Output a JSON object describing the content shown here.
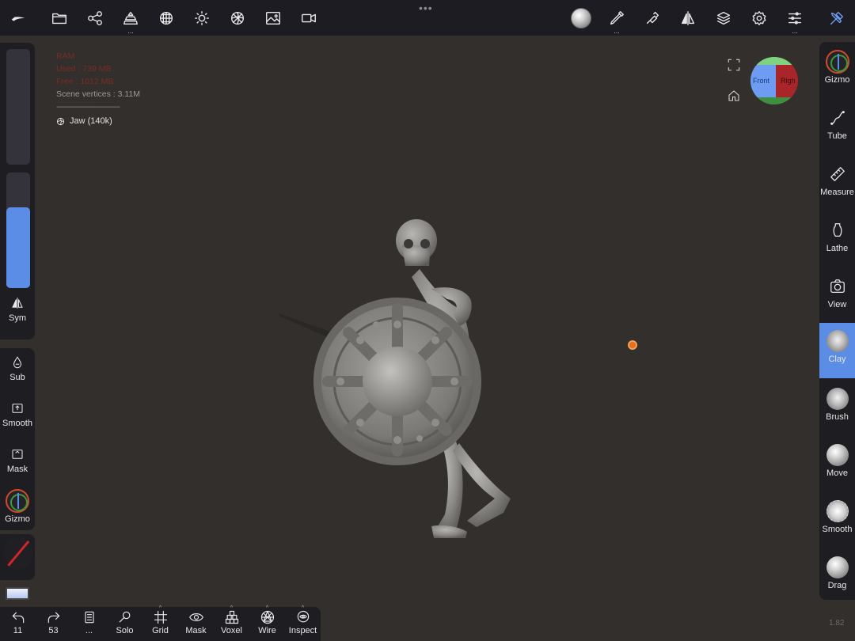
{
  "topbar": {
    "handle": "•••",
    "buttons": [
      {
        "name": "app-logo-icon"
      },
      {
        "name": "folder-icon"
      },
      {
        "name": "scene-graph-icon"
      },
      {
        "name": "primitive-icon",
        "more": "..."
      },
      {
        "name": "topology-icon"
      },
      {
        "name": "lighting-icon"
      },
      {
        "name": "shading-icon"
      },
      {
        "name": "background-icon"
      },
      {
        "name": "video-icon"
      },
      {
        "name": "material-ball-icon"
      },
      {
        "name": "paint-brush-icon",
        "more": "..."
      },
      {
        "name": "stroke-icon"
      },
      {
        "name": "symmetry-icon"
      },
      {
        "name": "layers-icon"
      },
      {
        "name": "settings-gear-icon"
      },
      {
        "name": "sliders-icon",
        "more": "..."
      },
      {
        "name": "tools-icon"
      }
    ]
  },
  "stats": {
    "ram_label": "RAM",
    "used": "Used : 739 MB",
    "free": "Free : 1012 MB",
    "scene_vertices": "Scene vertices : 3.11M",
    "separator": "--------------------------------",
    "object_name": "Jaw (140k)"
  },
  "navcube": {
    "front": "Front",
    "right": "Righ"
  },
  "left_sidebar": {
    "radius_fill": 0.7,
    "sym": "Sym",
    "sub": "Sub",
    "smooth": "Smooth",
    "mask": "Mask",
    "gizmo": "Gizmo"
  },
  "right_sidebar": [
    {
      "key": "gizmo",
      "label": "Gizmo"
    },
    {
      "key": "tube",
      "label": "Tube"
    },
    {
      "key": "measure",
      "label": "Measure"
    },
    {
      "key": "lathe",
      "label": "Lathe"
    },
    {
      "key": "view",
      "label": "View"
    },
    {
      "key": "clay",
      "label": "Clay",
      "active": true
    },
    {
      "key": "brush",
      "label": "Brush"
    },
    {
      "key": "move",
      "label": "Move"
    },
    {
      "key": "smooth",
      "label": "Smooth"
    },
    {
      "key": "drag",
      "label": "Drag"
    }
  ],
  "bottombar": {
    "undo": "11",
    "redo": "53",
    "history": "...",
    "solo": "Solo",
    "grid": "Grid",
    "mask": "Mask",
    "voxel": "Voxel",
    "wire": "Wire",
    "inspect": "Inspect"
  },
  "version": "1.82",
  "colors": {
    "accent": "#5b8de6",
    "background": "#332f2c",
    "panel": "#1e1d22",
    "pivot": "#e2701e"
  }
}
